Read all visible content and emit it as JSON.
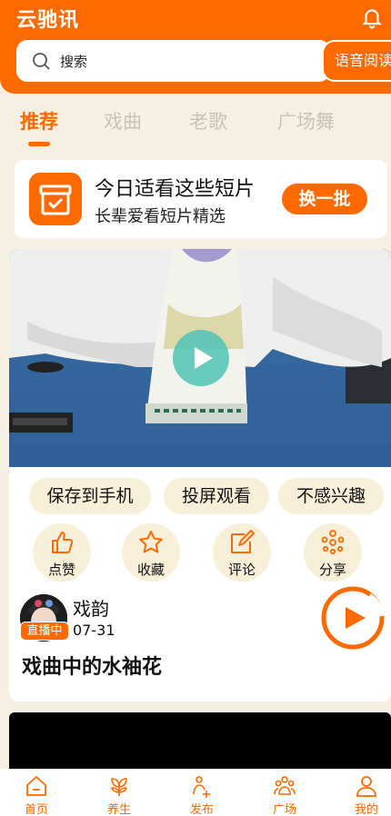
{
  "app": {
    "title": "云驰讯"
  },
  "header": {
    "search_placeholder": "搜索",
    "voice_button": "语音阅读"
  },
  "tabs": [
    {
      "label": "推荐",
      "active": true
    },
    {
      "label": "戏曲",
      "active": false
    },
    {
      "label": "老歌",
      "active": false
    },
    {
      "label": "广场舞",
      "active": false
    }
  ],
  "promo": {
    "title": "今日适看这些短片",
    "subtitle": "长辈爱看短片精选",
    "button": "换一批"
  },
  "video_card": {
    "actions_top": [
      "保存到手机",
      "投屏观看",
      "不感兴趣"
    ],
    "actions": [
      {
        "label": "点赞",
        "icon": "thumbs-up-icon"
      },
      {
        "label": "收藏",
        "icon": "star-icon"
      },
      {
        "label": "评论",
        "icon": "edit-icon"
      },
      {
        "label": "分享",
        "icon": "share-icon"
      }
    ],
    "author": "戏韵",
    "live_badge": "直播中",
    "date": "07-31",
    "title": "戏曲中的水袖花"
  },
  "bottom_nav": [
    {
      "label": "首页",
      "icon": "home-icon"
    },
    {
      "label": "养生",
      "icon": "leaf-icon"
    },
    {
      "label": "发布",
      "icon": "publish-icon"
    },
    {
      "label": "广场",
      "icon": "people-icon"
    },
    {
      "label": "我的",
      "icon": "user-icon"
    }
  ],
  "colors": {
    "accent": "#ff6a00",
    "background": "#f6f0e2",
    "pill": "#f7efd8",
    "play_button": "#4fc3b5"
  }
}
